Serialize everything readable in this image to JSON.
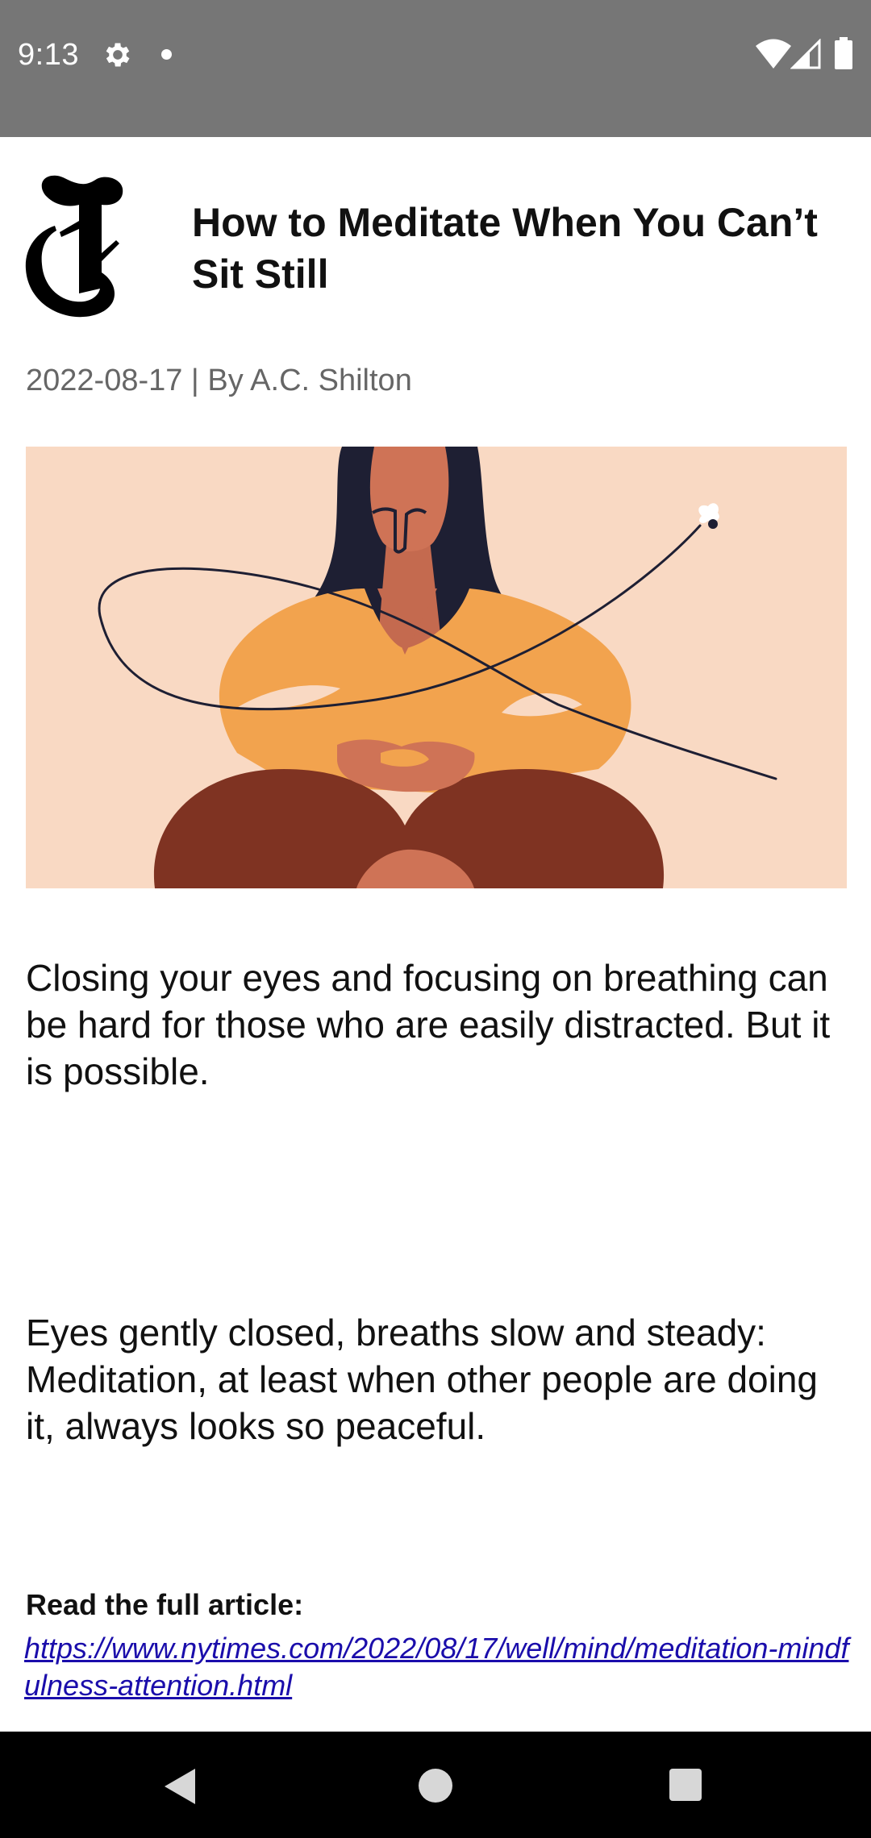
{
  "status_bar": {
    "time": "9:13",
    "icons": [
      "gear-icon",
      "notification-dot-icon",
      "wifi-icon",
      "cell-signal-icon",
      "battery-icon"
    ],
    "background_color": "#767676"
  },
  "article": {
    "publisher_logo": "nyt-t-logo",
    "title": "How to Meditate When You Can’t Sit Still",
    "byline": "2022-08-17 | By A.C. Shilton",
    "hero_image": "meditating-woman-illustration",
    "paragraphs": [
      "Closing your eyes and focusing on breathing can be hard for those who are easily distracted. But it is possible.",
      "Eyes gently closed, breaths slow and steady: Meditation, at least when other people are doing it, always looks so peaceful."
    ],
    "read_more_label": "Read the full article:",
    "link_text": "https://www.nytimes.com/2022/08/17/well/mind/meditation-mindfulness-attention.html"
  },
  "nav_bar": {
    "buttons": [
      "back-icon",
      "home-icon",
      "recents-icon"
    ]
  },
  "colors": {
    "link": "#1a0dab",
    "byline": "#666666",
    "hero_background": "#f9d9c3"
  }
}
